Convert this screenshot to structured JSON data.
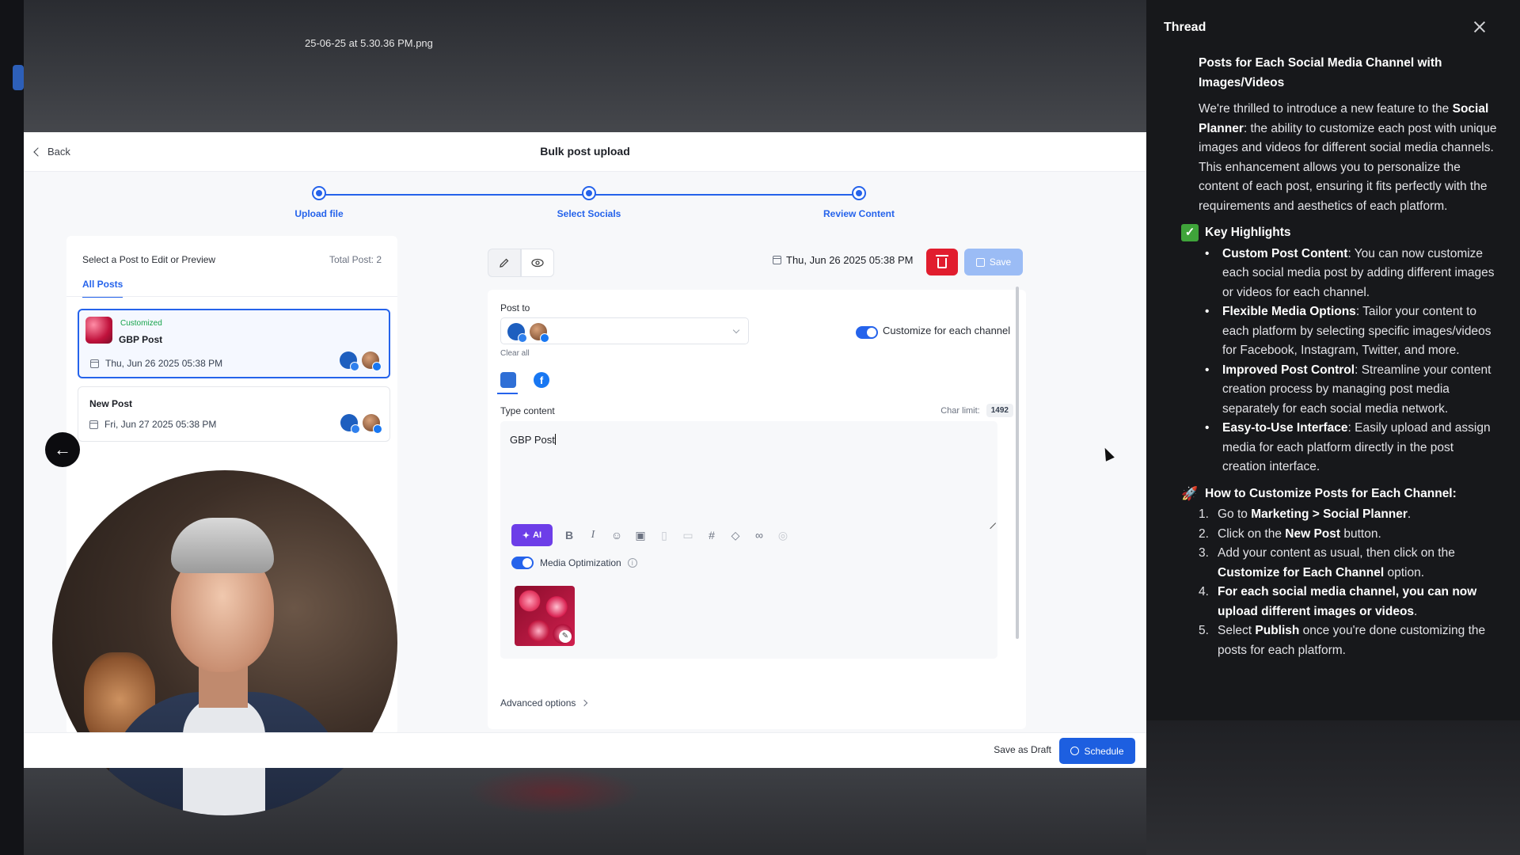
{
  "background": {
    "filename": "25-06-25 at 5.30.36 PM.png"
  },
  "header": {
    "back_label": "Back",
    "title": "Bulk post upload"
  },
  "stepper": {
    "steps": [
      {
        "label": "Upload file"
      },
      {
        "label": "Select Socials"
      },
      {
        "label": "Review Content"
      }
    ]
  },
  "left_panel": {
    "heading": "Select a Post to Edit or Preview",
    "total": "Total Post: 2",
    "tab": "All Posts",
    "posts": [
      {
        "badge": "Customized",
        "title": "GBP Post",
        "date": "Thu, Jun 26 2025 05:38 PM"
      },
      {
        "title": "New Post",
        "date": "Fri, Jun 27 2025 05:38 PM"
      }
    ]
  },
  "editor": {
    "date": "Thu, Jun 26 2025 05:38 PM",
    "save_label": "Save",
    "post_to_label": "Post to",
    "clear_all": "Clear all",
    "customize_label": "Customize for each channel",
    "type_content_label": "Type content",
    "char_limit_label": "Char limit:",
    "char_limit_value": "1492",
    "content": "GBP Post",
    "ai_label": "AI",
    "media_optimization_label": "Media Optimization",
    "advanced_options": "Advanced options"
  },
  "footer": {
    "save_draft": "Save as Draft",
    "schedule": "Schedule"
  },
  "thread": {
    "title": "Thread",
    "heading": "Posts for Each Social Media Channel with Images/Videos",
    "intro_a": "We're thrilled to introduce a new feature to the ",
    "intro_b": "Social Planner",
    "intro_c": ": the ability to customize each post with unique images and videos for different social media channels. This enhancement allows you to personalize the content of each post, ensuring it fits perfectly with the requirements and aesthetics of each platform.",
    "key_highlights": "Key Highlights",
    "highlights": [
      {
        "title": "Custom Post Content",
        "text": ": You can now customize each social media post by adding different images or videos for each channel."
      },
      {
        "title": "Flexible Media Options",
        "text": ": Tailor your content to each platform by selecting specific images/videos for Facebook, Instagram, Twitter, and more."
      },
      {
        "title": "Improved Post Control",
        "text": ": Streamline your content creation process by managing post media separately for each social media network."
      },
      {
        "title": "Easy-to-Use Interface",
        "text": ": Easily upload and assign media for each platform directly in the post creation interface."
      }
    ],
    "how_to": "How to Customize Posts for Each Channel:",
    "steps": [
      {
        "num": "1.",
        "a": "Go to ",
        "b": "Marketing > Social Planner",
        "c": "."
      },
      {
        "num": "2.",
        "a": "Click on the ",
        "b": "New Post",
        "c": " button."
      },
      {
        "num": "3.",
        "a": "Add your content as usual, then click on the ",
        "b": "Customize for Each Channel",
        "c": " option."
      },
      {
        "num": "4.",
        "a": "",
        "b": "For each social media channel, you can now upload different images or videos",
        "c": "."
      },
      {
        "num": "5.",
        "a": "Select ",
        "b": "Publish",
        "c": " once you're done customizing the posts for each platform."
      }
    ]
  }
}
